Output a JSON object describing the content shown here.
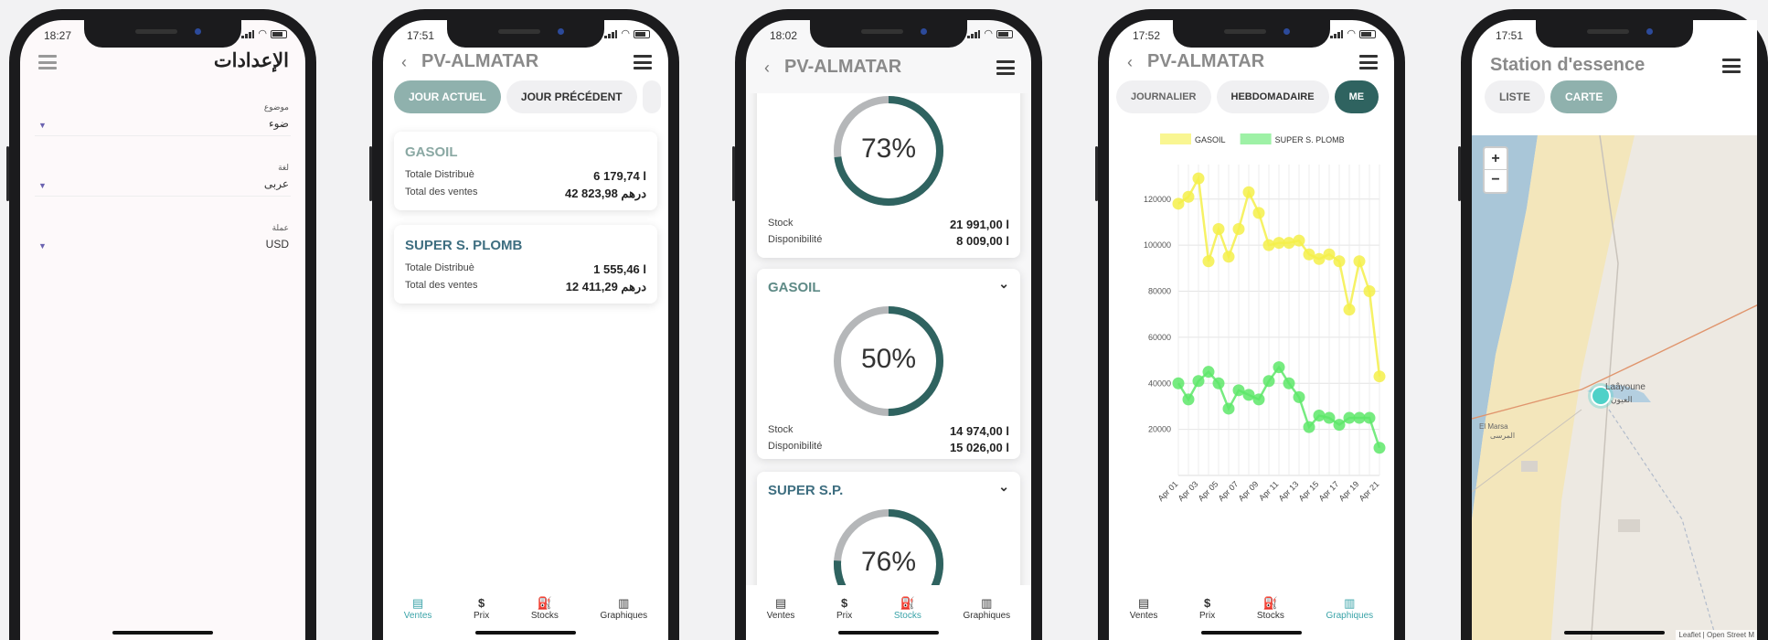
{
  "phone1": {
    "time": "18:27",
    "title": "الإعدادات",
    "fields": [
      {
        "label": "موضوع",
        "value": "ضوء"
      },
      {
        "label": "لغة",
        "value": "عربى"
      },
      {
        "label": "عملة",
        "value": "USD"
      }
    ]
  },
  "phone2": {
    "time": "17:51",
    "title": "PV-ALMATAR",
    "tabs": [
      "JOUR ACTUEL",
      "JOUR PRÉCÉDENT"
    ],
    "cards": [
      {
        "name": "GASOIL",
        "label1": "Totale Distribuè",
        "value1": "6 179,74 l",
        "label2": "Total des ventes",
        "value2": "42 823,98 درهم"
      },
      {
        "name": "SUPER S. PLOMB",
        "label1": "Totale Distribuè",
        "value1": "1 555,46 l",
        "label2": "Total des ventes",
        "value2": "12 411,29 درهم"
      }
    ]
  },
  "phone3": {
    "time": "18:02",
    "title": "PV-ALMATAR",
    "gauges": [
      {
        "name": "",
        "percent": 73,
        "pct_label": "73%",
        "label1": "Stock",
        "value1": "21 991,00 l",
        "label2": "Disponibilité",
        "value2": "8 009,00 l"
      },
      {
        "name": "GASOIL",
        "percent": 50,
        "pct_label": "50%",
        "label1": "Stock",
        "value1": "14 974,00 l",
        "label2": "Disponibilité",
        "value2": "15 026,00 l"
      },
      {
        "name": "SUPER S.P.",
        "percent": 76,
        "pct_label": "76%"
      }
    ]
  },
  "phone4": {
    "time": "17:52",
    "title": "PV-ALMATAR",
    "tabs": [
      "JOURNALIER",
      "HEBDOMADAIRE",
      "ME"
    ]
  },
  "phone5": {
    "time": "17:51",
    "title": "Station d'essence",
    "tabs": [
      "LISTE",
      "CARTE"
    ],
    "zoom_in": "+",
    "zoom_out": "−",
    "labels": {
      "city": "Laâyoune",
      "city_ar": "العيون",
      "marsa": "El Marsa",
      "marsa_ar": "المرسى"
    },
    "attribution": "Leaflet | Open Street M"
  },
  "nav": [
    "Ventes",
    "Prix",
    "Stocks",
    "Graphiques"
  ],
  "chart_data": {
    "type": "line",
    "title": "",
    "xlabel": "",
    "ylabel": "",
    "ylim": [
      0,
      135000
    ],
    "yticks": [
      "20000",
      "40000",
      "60000",
      "80000",
      "100000",
      "120000"
    ],
    "x": [
      "Apr 01",
      "Apr 02",
      "Apr 03",
      "Apr 04",
      "Apr 05",
      "Apr 06",
      "Apr 07",
      "Apr 08",
      "Apr 09",
      "Apr 10",
      "Apr 11",
      "Apr 12",
      "Apr 13",
      "Apr 14",
      "Apr 15",
      "Apr 16",
      "Apr 17",
      "Apr 18",
      "Apr 19",
      "Apr 20",
      "Apr 21"
    ],
    "xtick_labels": [
      "Apr 01",
      "Apr 03",
      "Apr 05",
      "Apr 07",
      "Apr 09",
      "Apr 11",
      "Apr 13",
      "Apr 15",
      "Apr 17",
      "Apr 19",
      "Apr 21"
    ],
    "legend_position": "top",
    "series": [
      {
        "name": "GASOIL",
        "color": "#f5f04a",
        "values": [
          118000,
          121000,
          129000,
          93000,
          107000,
          95000,
          107000,
          123000,
          114000,
          100000,
          101000,
          101000,
          102000,
          96000,
          94000,
          96000,
          93000,
          72000,
          93000,
          80000,
          43000
        ]
      },
      {
        "name": "SUPER S. PLOMB",
        "color": "#5ee86a",
        "values": [
          40000,
          33000,
          41000,
          45000,
          40000,
          29000,
          37000,
          35000,
          33000,
          41000,
          47000,
          40000,
          34000,
          21000,
          26000,
          25000,
          22000,
          25000,
          25000,
          25000,
          12000
        ]
      }
    ]
  }
}
